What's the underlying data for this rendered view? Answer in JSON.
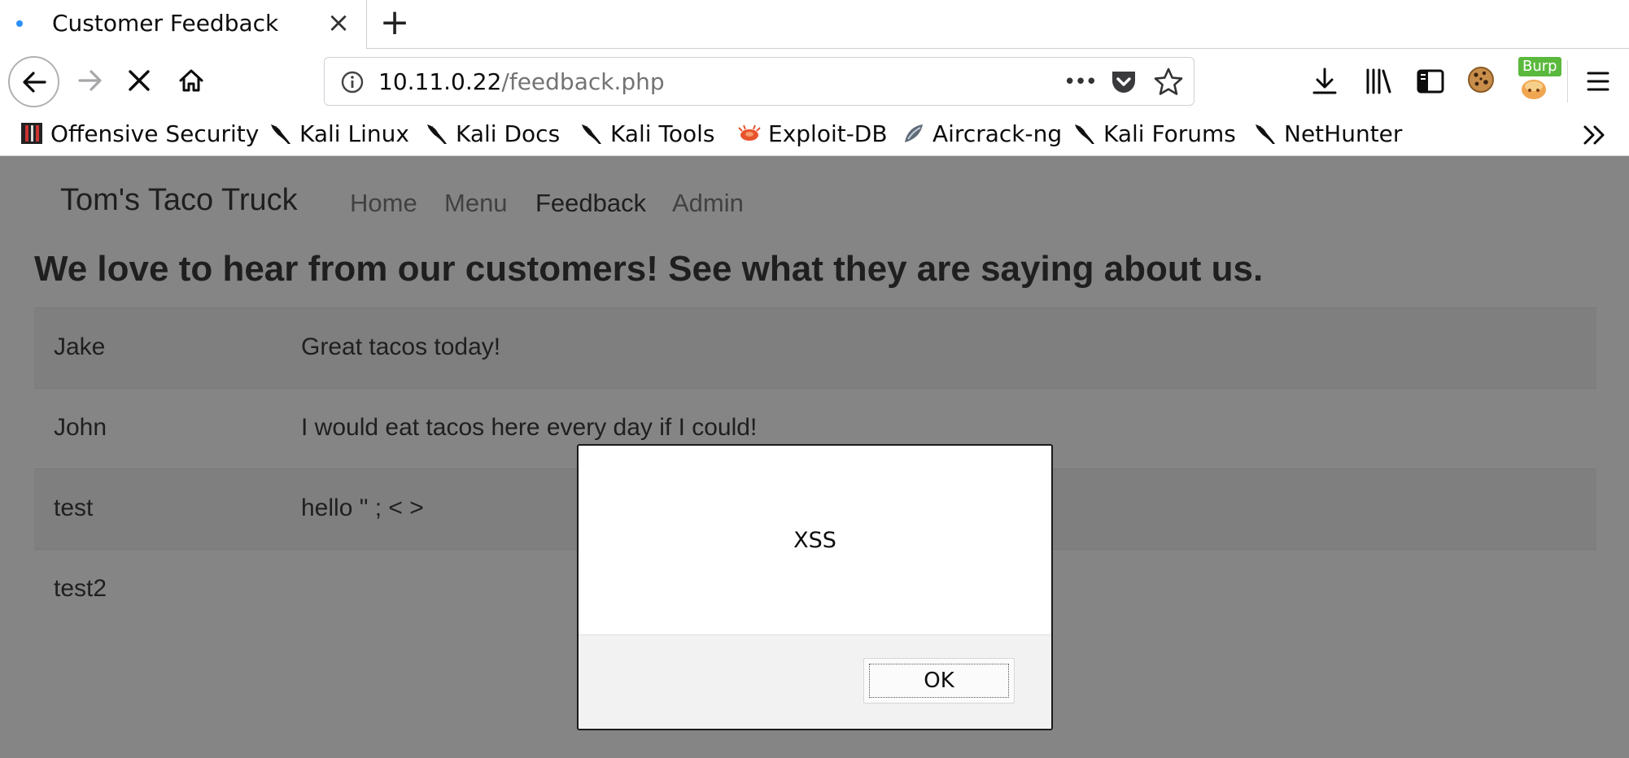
{
  "browser": {
    "tab": {
      "title": "Customer Feedback",
      "close_icon": "close-icon"
    },
    "new_tab_icon": "plus-icon",
    "nav": {
      "back_icon": "arrow-left-icon",
      "forward_icon": "arrow-right-icon",
      "stop_icon": "stop-icon",
      "home_icon": "home-icon"
    },
    "url": {
      "host": "10.11.0.22",
      "path": "/feedback.php"
    },
    "url_icons": [
      "info-icon",
      "page-actions-icon",
      "pocket-icon",
      "bookmark-star-icon"
    ],
    "toolbar_icons": [
      "download-icon",
      "library-icon",
      "sidebar-icon",
      "cookie-icon",
      "burp-icon",
      "menu-icon"
    ],
    "burp_badge": "Burp",
    "bookmarks": [
      {
        "label": "Offensive Security",
        "icon": "offsec-icon"
      },
      {
        "label": "Kali Linux",
        "icon": "kali-dragon-icon"
      },
      {
        "label": "Kali Docs",
        "icon": "kali-dragon-icon"
      },
      {
        "label": "Kali Tools",
        "icon": "kali-dragon-icon"
      },
      {
        "label": "Exploit-DB",
        "icon": "exploit-db-icon"
      },
      {
        "label": "Aircrack-ng",
        "icon": "aircrack-icon"
      },
      {
        "label": "Kali Forums",
        "icon": "kali-dragon-icon"
      },
      {
        "label": "NetHunter",
        "icon": "kali-dragon-icon"
      }
    ],
    "bookmarks_overflow_icon": "chevron-double-right-icon"
  },
  "site": {
    "brand": "Tom's Taco Truck",
    "nav": [
      "Home",
      "Menu",
      "Feedback",
      "Admin"
    ],
    "active_nav": "Feedback",
    "heading": "We love to hear from our customers! See what they are saying about us.",
    "feedback": [
      {
        "name": "Jake",
        "message": "Great tacos today!"
      },
      {
        "name": "John",
        "message": "I would eat tacos here every day if I could!"
      },
      {
        "name": "test",
        "message": "hello \" ; < >"
      },
      {
        "name": "test2",
        "message": ""
      }
    ]
  },
  "alert": {
    "message": "XSS",
    "ok_label": "OK"
  },
  "colors": {
    "overlay": "#0c0c0d80",
    "tab_accent": "#2a8ff7",
    "burp_badge": "#5ab93d",
    "row_stripe": "#f2f2f2"
  }
}
